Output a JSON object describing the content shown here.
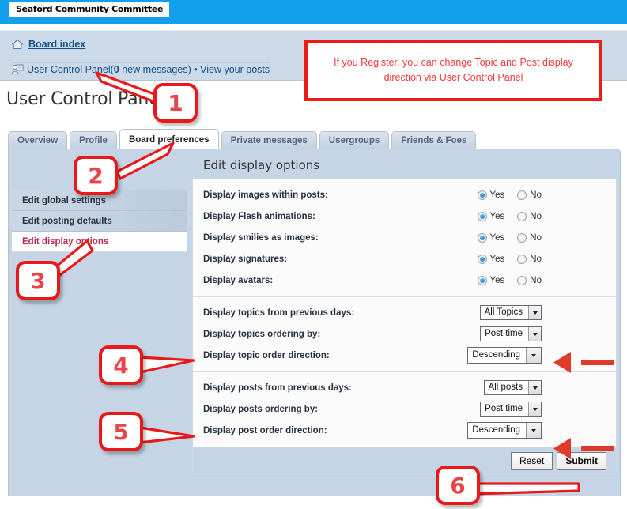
{
  "banner": {
    "logo_text": "Seaford Community Committee",
    "bg": "#12a0ec"
  },
  "breadcrumb": {
    "home_label": "Board index",
    "ucp_label": "User Control Panel",
    "ucp_count_open": "(",
    "ucp_count": "0",
    "ucp_count_rest": " new messages)",
    "separator": "•",
    "view_posts_label": "View your posts"
  },
  "page": {
    "title": "User Control Panel"
  },
  "tabs": [
    {
      "label": "Overview",
      "active": false
    },
    {
      "label": "Profile",
      "active": false
    },
    {
      "label": "Board preferences",
      "active": true
    },
    {
      "label": "Private messages",
      "active": false
    },
    {
      "label": "Usergroups",
      "active": false
    },
    {
      "label": "Friends & Foes",
      "active": false
    }
  ],
  "sidebar": {
    "items": [
      {
        "label": "Edit global settings",
        "active": false
      },
      {
        "label": "Edit posting defaults",
        "active": false
      },
      {
        "label": "Edit display options",
        "active": true
      }
    ]
  },
  "content": {
    "heading": "Edit display options",
    "radio_rows": [
      {
        "label": "Display images within posts:",
        "yes": "Yes",
        "no": "No",
        "value": "yes"
      },
      {
        "label": "Display Flash animations:",
        "yes": "Yes",
        "no": "No",
        "value": "yes"
      },
      {
        "label": "Display smilies as images:",
        "yes": "Yes",
        "no": "No",
        "value": "yes"
      },
      {
        "label": "Display signatures:",
        "yes": "Yes",
        "no": "No",
        "value": "yes"
      },
      {
        "label": "Display avatars:",
        "yes": "Yes",
        "no": "No",
        "value": "yes"
      }
    ],
    "topic_rows": [
      {
        "label": "Display topics from previous days:",
        "value": "All Topics",
        "highlight": false
      },
      {
        "label": "Display topics ordering by:",
        "value": "Post time",
        "highlight": false
      },
      {
        "label": "Display topic order direction:",
        "value": "Descending",
        "highlight": true
      }
    ],
    "post_rows": [
      {
        "label": "Display posts from previous days:",
        "value": "All posts",
        "highlight": false
      },
      {
        "label": "Display posts ordering by:",
        "value": "Post time",
        "highlight": false
      },
      {
        "label": "Display post order direction:",
        "value": "Descending",
        "highlight": true
      }
    ],
    "buttons": {
      "reset": "Reset",
      "submit": "Submit"
    }
  },
  "annotations": {
    "note": "If you Register, you can change Topic and Post display direction via User Control Panel",
    "markers": [
      {
        "id": "1",
        "number": "1"
      },
      {
        "id": "2",
        "number": "2"
      },
      {
        "id": "3",
        "number": "3"
      },
      {
        "id": "4",
        "number": "4"
      },
      {
        "id": "5",
        "number": "5"
      },
      {
        "id": "6",
        "number": "6"
      }
    ],
    "accent_color": "#e8191b"
  }
}
